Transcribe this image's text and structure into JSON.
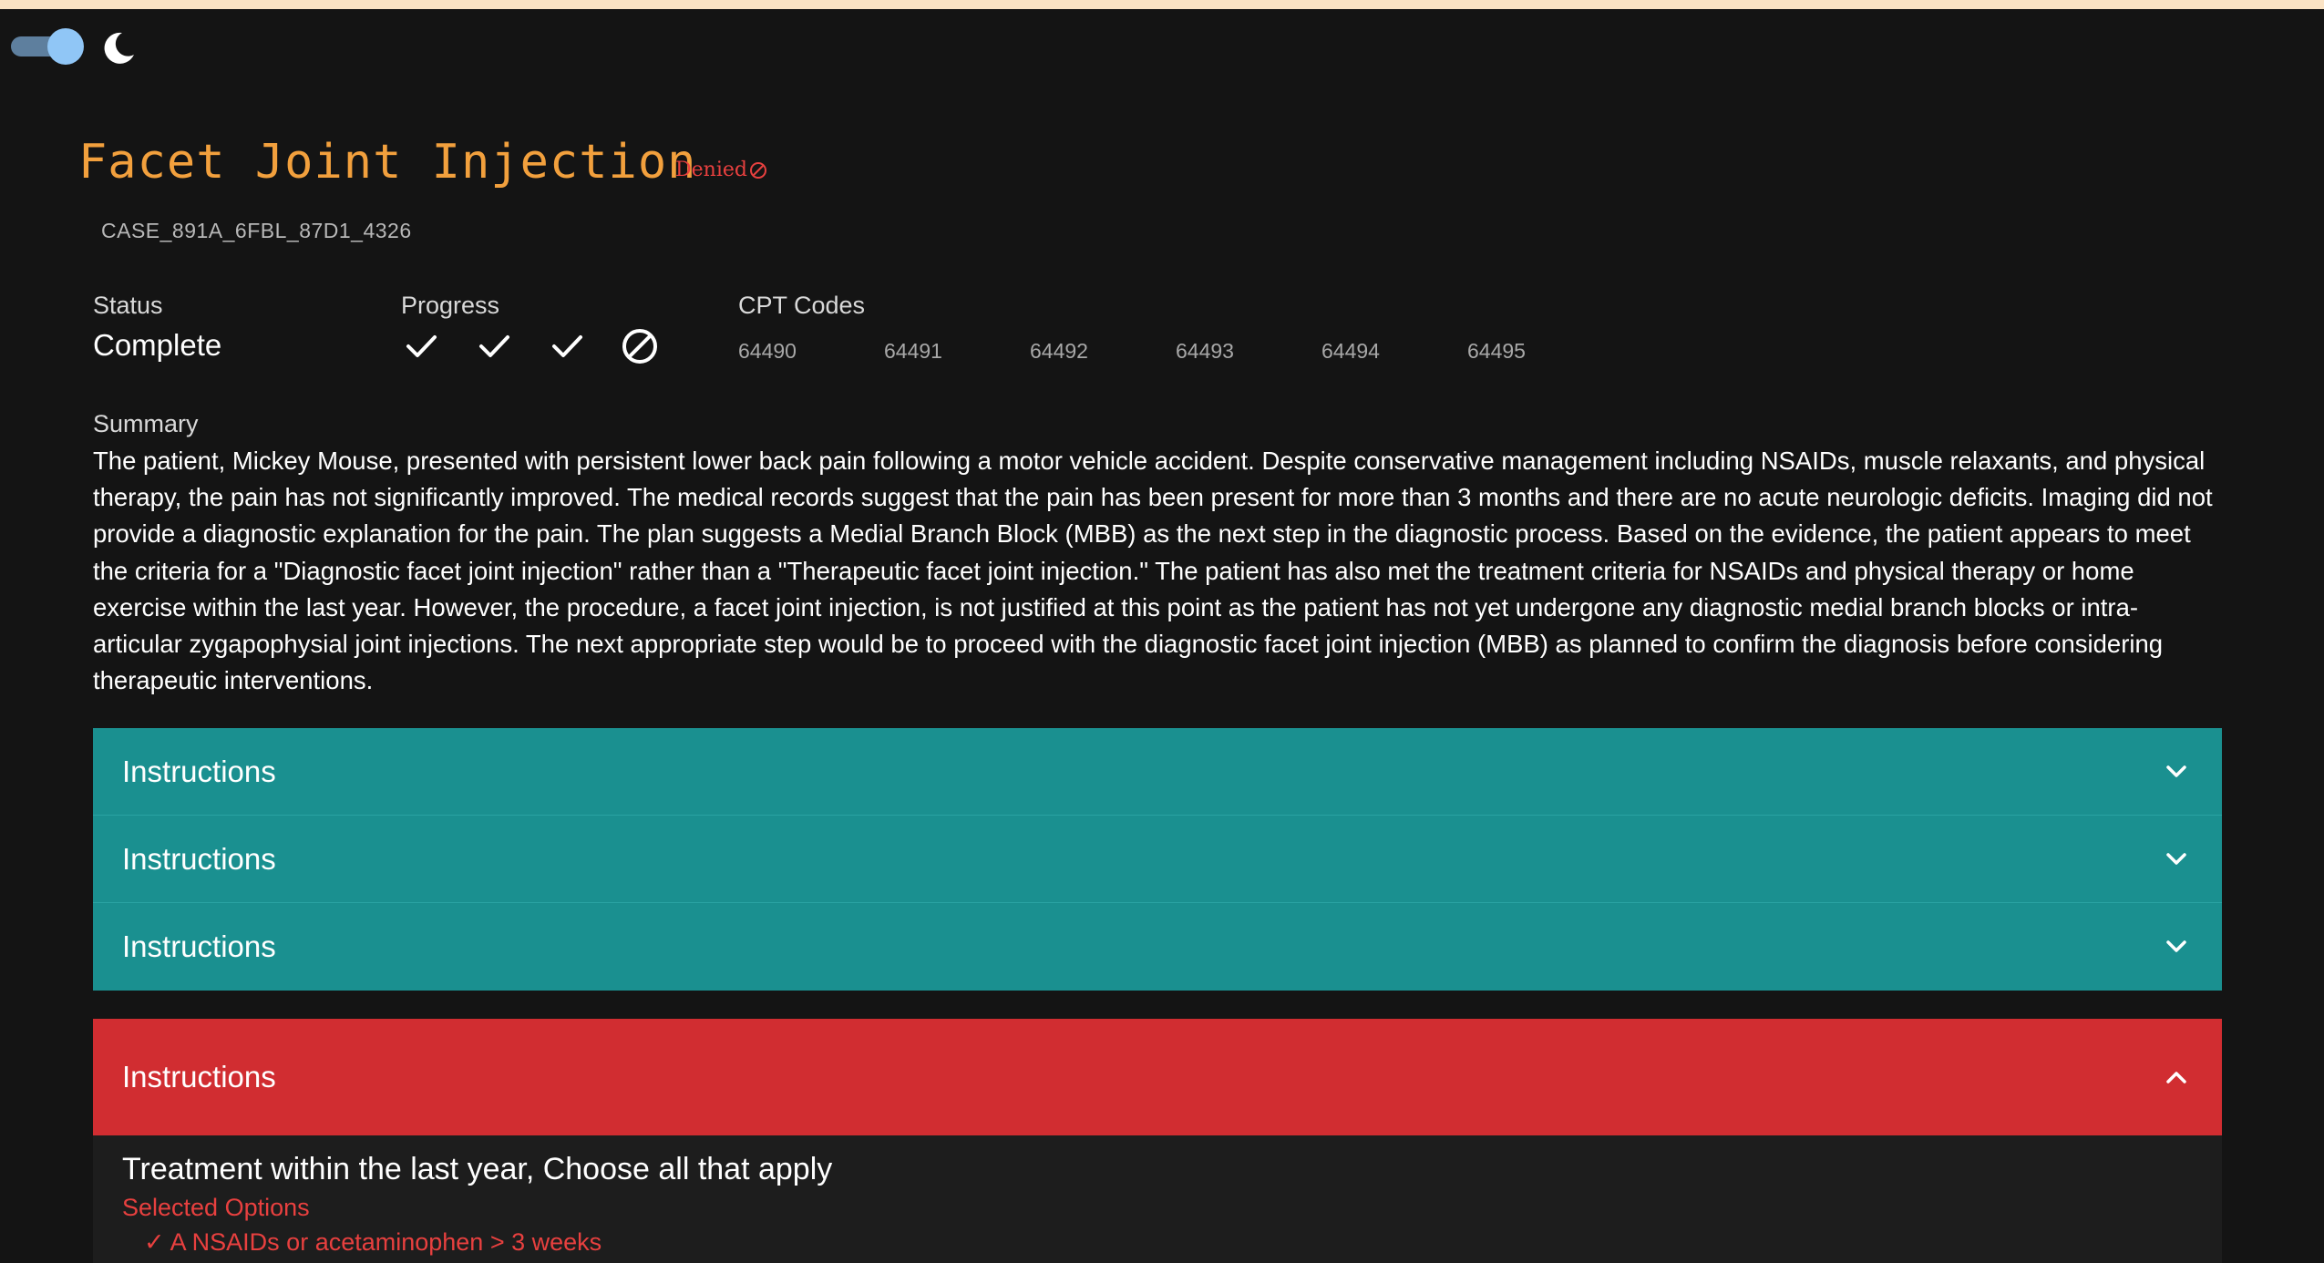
{
  "header": {
    "title": "Facet Joint Injection",
    "badge": "Denied",
    "case_id": "CASE_891A_6FBL_87D1_4326",
    "theme_toggle_on": true
  },
  "status": {
    "label": "Status",
    "value": "Complete"
  },
  "progress": {
    "label": "Progress",
    "steps": [
      "check",
      "check",
      "check",
      "denied"
    ]
  },
  "cpt": {
    "label": "CPT Codes",
    "codes": [
      "64490",
      "64491",
      "64492",
      "64493",
      "64494",
      "64495"
    ]
  },
  "summary": {
    "label": "Summary",
    "text": "The patient, Mickey Mouse, presented with persistent lower back pain following a motor vehicle accident. Despite conservative management including NSAIDs, muscle relaxants, and physical therapy, the pain has not significantly improved. The medical records suggest that the pain has been present for more than 3 months and there are no acute neurologic deficits. Imaging did not provide a diagnostic explanation for the pain. The plan suggests a Medial Branch Block (MBB) as the next step in the diagnostic process. Based on the evidence, the patient appears to meet the criteria for a \"Diagnostic facet joint injection\" rather than a \"Therapeutic facet joint injection.\" The patient has also met the treatment criteria for NSAIDs and physical therapy or home exercise within the last year. However, the procedure, a facet joint injection, is not justified at this point as the patient has not yet undergone any diagnostic medial branch blocks or intra-articular zygapophysial joint injections. The next appropriate step would be to proceed with the diagnostic facet joint injection (MBB) as planned to confirm the diagnosis before considering therapeutic interventions."
  },
  "accordions": [
    {
      "label": "Instructions",
      "expanded": false
    },
    {
      "label": "Instructions",
      "expanded": false
    },
    {
      "label": "Instructions",
      "expanded": false
    }
  ],
  "open_accordion": {
    "label": "Instructions",
    "expanded": true,
    "question": "Treatment within the last year, Choose all that apply",
    "selected_label": "Selected Options",
    "selected_items": [
      "A NSAIDs or acetaminophen > 3 weeks"
    ]
  },
  "colors": {
    "title": "#f2a03d",
    "denied": "#e8403f",
    "teal": "#1a9090",
    "red": "#d12d31",
    "background": "#141414",
    "top_bar": "#fbe3c4"
  }
}
